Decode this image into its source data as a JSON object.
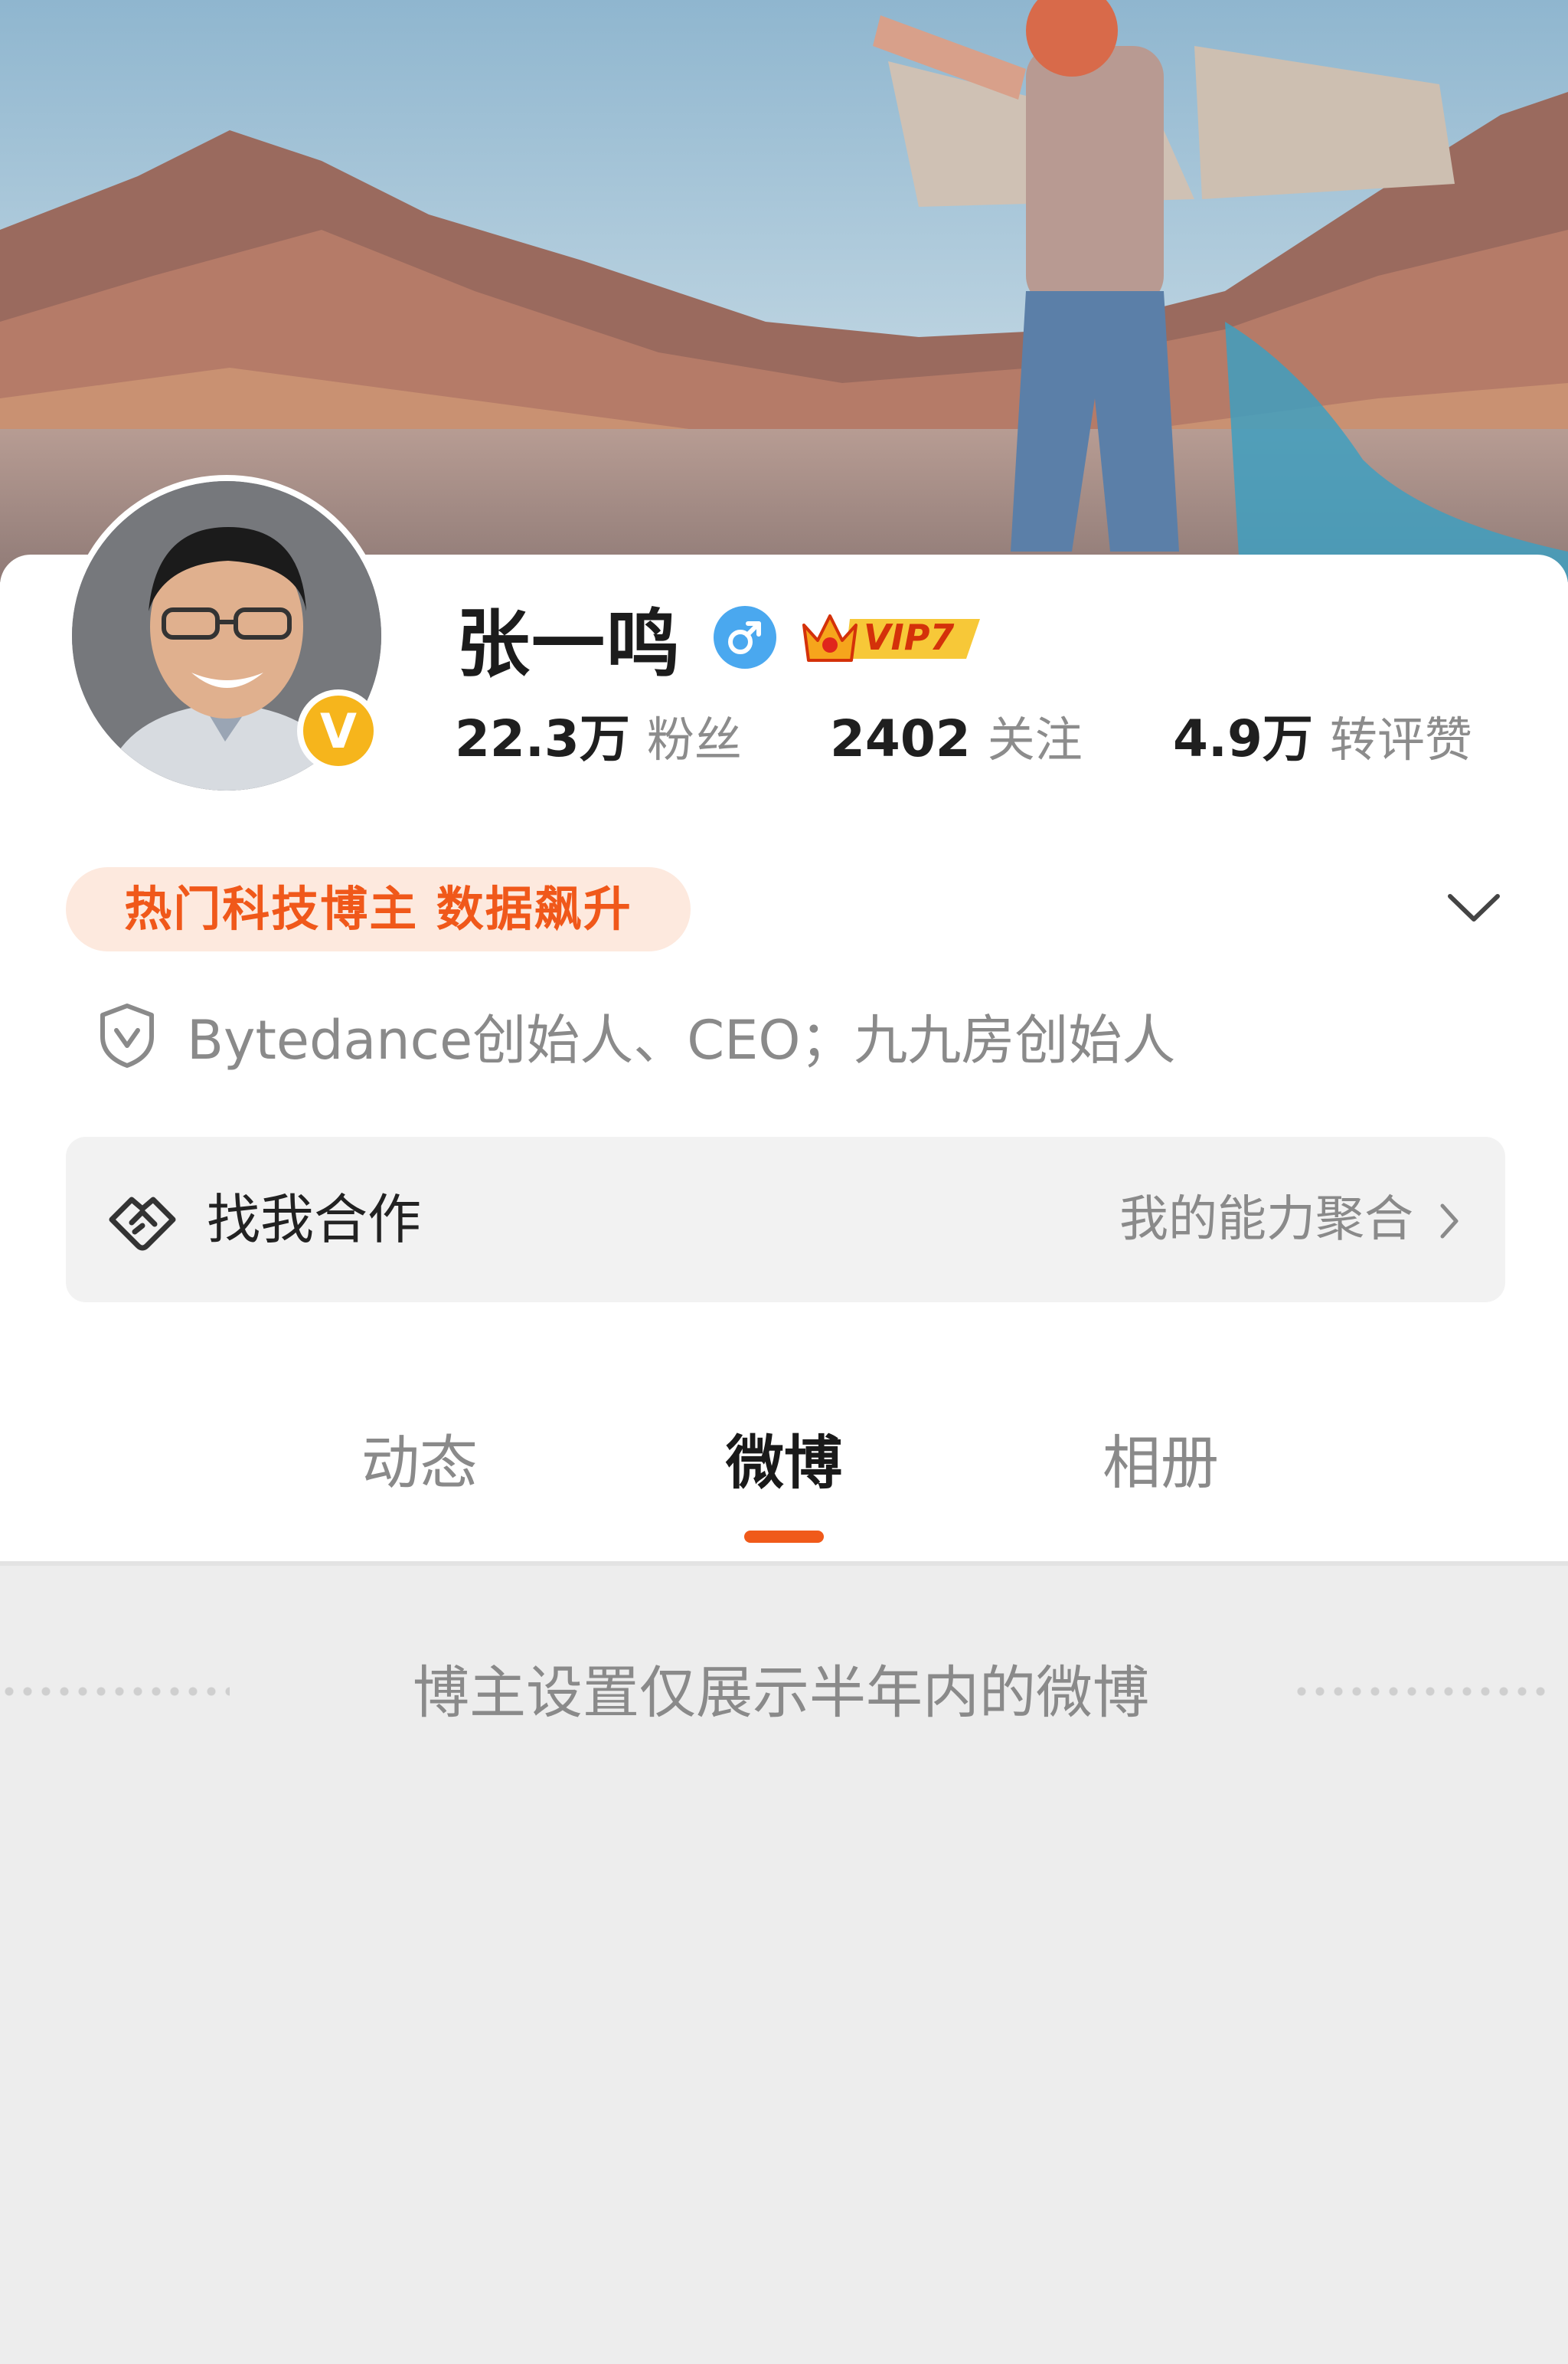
{
  "profile": {
    "name": "张一鸣",
    "verified_mark": "V",
    "gender_icon": "male-icon",
    "vip_label": "VIP7",
    "stats": [
      {
        "num": "22.3万",
        "label": "粉丝"
      },
      {
        "num": "2402",
        "label": "关注"
      },
      {
        "num": "4.9万",
        "label": "转评赞"
      }
    ],
    "hot_tag": "热门科技博主 数据飙升",
    "bio": "Bytedance创始人、CEO；九九房创始人"
  },
  "cooperation": {
    "title": "找我合作",
    "subtitle": "我的能力聚合"
  },
  "tabs": [
    "动态",
    "微博",
    "相册"
  ],
  "active_tab": "微博",
  "notice": "博主设置仅展示半年内的微博",
  "colors": {
    "accent": "#f05a1a",
    "hot_tag_bg": "#fde9de",
    "verified": "#f6b51c",
    "gender": "#4aa8ef",
    "page_bg": "#ededed"
  }
}
